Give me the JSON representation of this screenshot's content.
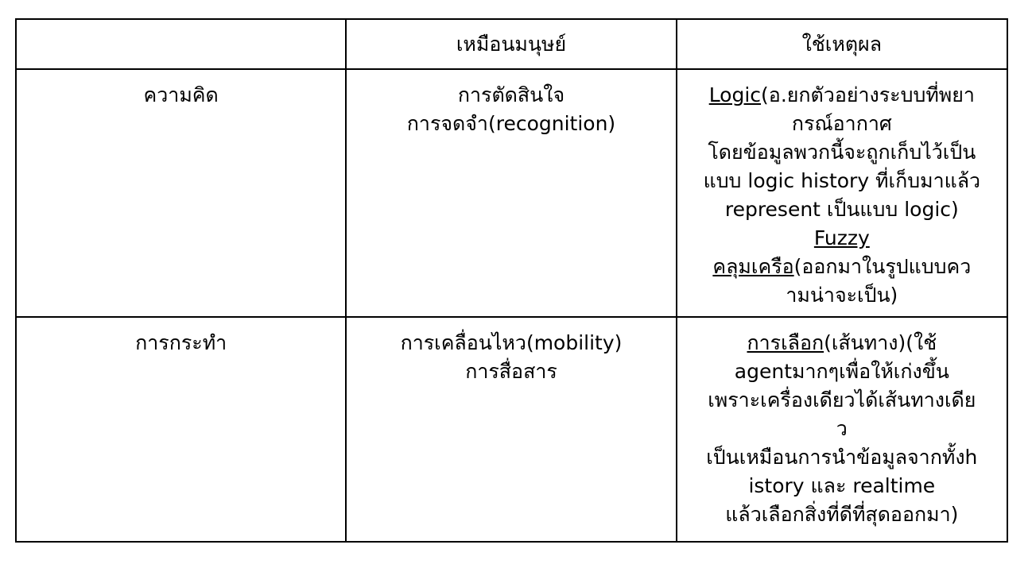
{
  "table": {
    "header": {
      "col1": "",
      "col2": "เหมือนมนุษย์",
      "col3": "ใช้เหตุผล"
    },
    "rows": [
      {
        "label": "ความคิด",
        "human_lines": [
          "การตัดสินใจ",
          "การจดจำ(recognition)"
        ],
        "reason": {
          "logic_term": "Logic",
          "logic_rest_line1": "(อ.ยกตัวอย่างระบบที่พยา",
          "logic_line2": "กรณ์อากาศ",
          "logic_line3": "โดยข้อมูลพวกนี้จะถูกเก็บไว้เป็น",
          "logic_line4": "แบบ logic history ที่เก็บมาแล้ว",
          "logic_line5": "represent เป็นแบบ logic)",
          "fuzzy_term": "Fuzzy",
          "fuzzy_word": "คลุมเครือ",
          "fuzzy_rest_line1": "(ออกมาในรูปแบบคว",
          "fuzzy_line2": "ามน่าจะเป็น)"
        }
      },
      {
        "label": "การกระทำ",
        "human_lines": [
          "การเคลื่อนไหว(mobility)",
          "การสื่อสาร"
        ],
        "reason": {
          "choice_term": "การเลือก",
          "choice_rest_line1": "(เส้นทาง)(ใช้",
          "line2": "agentมากๆเพื่อให้เก่งขึ้น",
          "line3": "เพราะเครื่องเดียวได้เส้นทางเดีย",
          "line4": "ว",
          "line5": "เป็นเหมือนการนำข้อมูลจากทั้งh",
          "line6": "istory และ realtime",
          "line7": "แล้วเลือกสิ่งที่ดีที่สุดออกมา)"
        }
      }
    ]
  }
}
